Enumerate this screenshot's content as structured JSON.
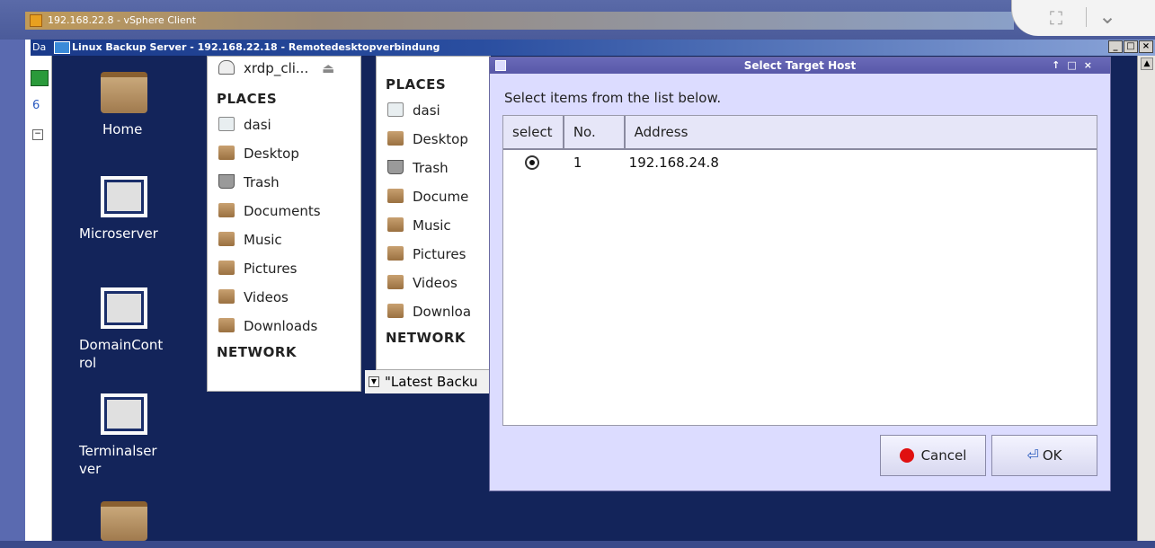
{
  "vsphere": {
    "title": "192.168.22.8 - vSphere Client"
  },
  "rdp": {
    "title": "Linux Backup Server - 192.168.22.18 - Remotedesktopverbindung",
    "prefix": "Da"
  },
  "desktop_icons": [
    {
      "label": "Home",
      "kind": "folder"
    },
    {
      "label": "Microserver",
      "kind": "screen"
    },
    {
      "label": "DomainCont rol",
      "kind": "screen"
    },
    {
      "label": "Terminalser ver",
      "kind": "screen"
    }
  ],
  "fm1": {
    "device": "xrdp_cli...",
    "places_header": "PLACES",
    "items": [
      "dasi",
      "Desktop",
      "Trash",
      "Documents",
      "Music",
      "Pictures",
      "Videos",
      "Downloads"
    ],
    "network_header": "NETWORK"
  },
  "fm2": {
    "places_header": "PLACES",
    "items": [
      "dasi",
      "Desktop",
      "Trash",
      "Docume",
      "Music",
      "Pictures",
      "Videos",
      "Downloa"
    ],
    "network_header": "NETWORK",
    "status": "\"Latest Backu"
  },
  "dialog": {
    "title": "Select Target Host",
    "message": "Select items from the list below.",
    "columns": [
      "select",
      "No.",
      "Address"
    ],
    "rows": [
      {
        "selected": true,
        "no": "1",
        "address": "192.168.24.8"
      }
    ],
    "cancel_label": "Cancel",
    "ok_label": "OK"
  }
}
